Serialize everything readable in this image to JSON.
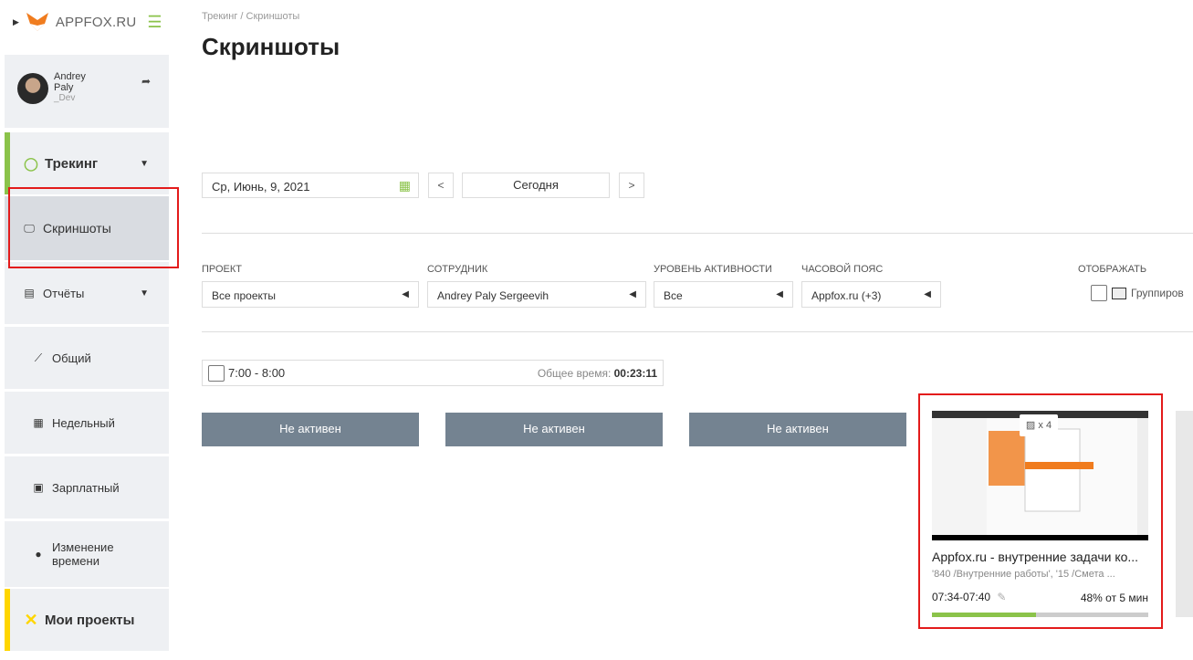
{
  "sidebar": {
    "logo": "APPFOX.RU",
    "user": {
      "first": "Andrey",
      "last": "Paly",
      "role": "_Dev"
    },
    "tracking": "Трекинг",
    "screenshots": "Скриншоты",
    "reports": "Отчёты",
    "general": "Общий",
    "weekly": "Недельный",
    "salary": "Зарплатный",
    "time_change": [
      "Изменение",
      "времени"
    ],
    "my_projects": "Мои проекты"
  },
  "header": {
    "breadcrumb": "Трекинг / Скриншоты",
    "title": "Скриншоты"
  },
  "date_nav": {
    "date": "Ср, Июнь, 9, 2021",
    "prev": "<",
    "today": "Сегодня",
    "next": ">"
  },
  "filters": {
    "project": {
      "label": "ПРОЕКТ",
      "value": "Все проекты"
    },
    "employee": {
      "label": "СОТРУДНИК",
      "value": "Andrey Paly Sergeevih"
    },
    "activity": {
      "label": "УРОВЕНЬ АКТИВНОСТИ",
      "value": "Все"
    },
    "timezone": {
      "label": "ЧАСОВОЙ ПОЯС",
      "value": "Appfox.ru (+3)"
    },
    "display": {
      "label": "ОТОБРАЖАТЬ",
      "option": "Группиров"
    }
  },
  "hour_block": {
    "range": "7:00 - 8:00",
    "total_label": "Общее время:",
    "total_value": "00:23:11"
  },
  "slots": [
    "Не активен",
    "Не активен",
    "Не активен"
  ],
  "card": {
    "count": "x 4",
    "title": "Appfox.ru - внутренние задачи ко...",
    "subtitle": "'840 /Внутренние работы', '15 /Смета ...",
    "time": "07:34-07:40",
    "activity": "48% от 5 мин",
    "activity_fraction": 0.48
  },
  "colors": {
    "accent": "#8bc34a",
    "inactive": "#748391",
    "highlight": "#e31b1b"
  }
}
